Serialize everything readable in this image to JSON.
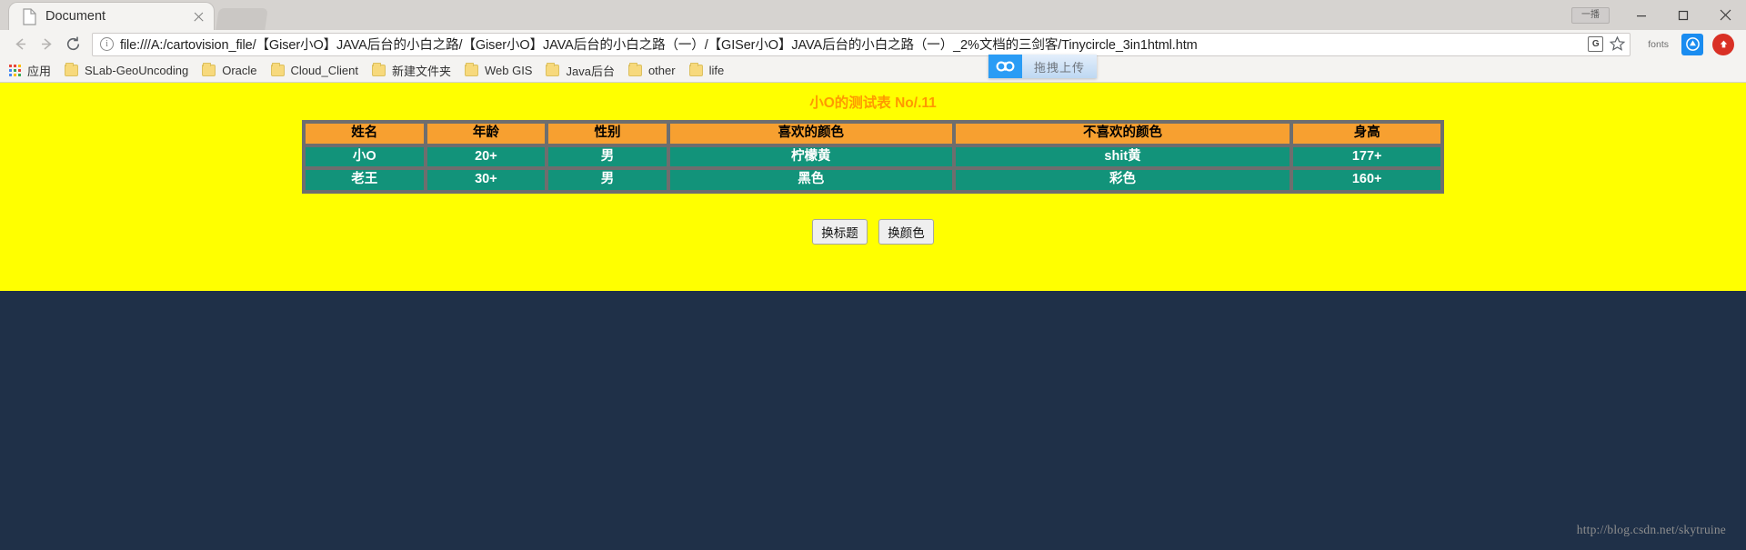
{
  "window": {
    "plugin_badge": "一播",
    "minimize_label": "Minimize",
    "maximize_label": "Maximize",
    "close_label": "Close"
  },
  "tab": {
    "title": "Document",
    "close_label": "×",
    "favicon": "document-icon"
  },
  "toolbar": {
    "back_label": "Back",
    "forward_label": "Forward",
    "reload_label": "Reload",
    "info_glyph": "ⓘ",
    "url": "file:///A:/cartovision_file/【Giser小O】JAVA后台的小白之路/【Giser小O】JAVA后台的小白之路（一）/【GISer小O】JAVA后台的小白之路（一）_2%文档的三剑客/Tinycircle_3in1html.htm",
    "translate_glyph": "G",
    "star_label": "Bookmark this page",
    "extension_label": "fonts",
    "ext_blue_glyph": "◉",
    "ext_red_glyph": "⬆"
  },
  "baidu_overlay": {
    "logo": "baidu-cloud-icon",
    "text": "拖拽上传"
  },
  "bookmarks": [
    {
      "label": "应用",
      "icon": "apps-grid-icon"
    },
    {
      "label": "SLab-GeoUncoding",
      "icon": "folder-icon"
    },
    {
      "label": "Oracle",
      "icon": "folder-icon"
    },
    {
      "label": "Cloud_Client",
      "icon": "folder-icon"
    },
    {
      "label": "新建文件夹",
      "icon": "folder-icon"
    },
    {
      "label": "Web GIS",
      "icon": "folder-icon"
    },
    {
      "label": "Java后台",
      "icon": "folder-icon"
    },
    {
      "label": "other",
      "icon": "folder-icon"
    },
    {
      "label": "life",
      "icon": "folder-icon"
    }
  ],
  "page": {
    "title": "小O的测试表 No/.11",
    "background_color": "#ffff00",
    "title_color": "#ff9900",
    "header_color": "#f7a030",
    "cell_color": "#12937a",
    "table": {
      "headers": [
        "姓名",
        "年龄",
        "性别",
        "喜欢的颜色",
        "不喜欢的颜色",
        "身高"
      ],
      "rows": [
        [
          "小O",
          "20+",
          "男",
          "柠檬黄",
          "shit黄",
          "177+"
        ],
        [
          "老王",
          "30+",
          "男",
          "黑色",
          "彩色",
          "160+"
        ]
      ]
    },
    "buttons": [
      {
        "label": "换标题"
      },
      {
        "label": "换颜色"
      }
    ]
  },
  "footer": {
    "watermark": "http://blog.csdn.net/skytruine",
    "background_color": "#1f3048"
  }
}
